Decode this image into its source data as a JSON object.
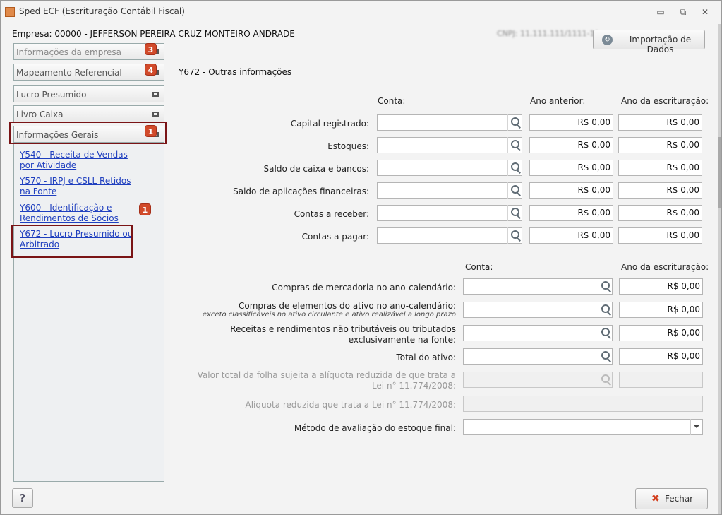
{
  "window": {
    "title": "Sped ECF (Escrituração Contábil Fiscal)",
    "icons": {
      "app": "spreadsheet-icon",
      "minimize": "minimize-icon",
      "maximize": "restore-icon",
      "close": "close-icon"
    },
    "minimize_glyph": "▭",
    "maximize_glyph": "⧉",
    "close_glyph": "✕"
  },
  "header": {
    "company": "Empresa: 00000 - JEFFERSON PEREIRA CRUZ MONTEIRO ANDRADE",
    "cnpj": "CNPJ: 11.111.111/1111-11",
    "import_button": "Importação de Dados",
    "import_icon": "import-circle-icon",
    "import_icon_glyph": "↻"
  },
  "sidebar": {
    "sections": [
      {
        "label": "Informações da empresa",
        "badge": "3"
      },
      {
        "label": "Mapeamento Referencial",
        "badge": "4"
      },
      {
        "label": "Lucro Presumido"
      },
      {
        "label": "Livro Caixa"
      },
      {
        "label": "Informações Gerais",
        "badge": "1"
      }
    ],
    "links": [
      {
        "label": "Y540 - Receita de Vendas por Atividade"
      },
      {
        "label": "Y570 - IRPJ e CSLL Retidos na Fonte"
      },
      {
        "label": "Y600 - Identificação e Rendimentos de Sócios",
        "badge": "1"
      },
      {
        "label": "Y672 - Lucro Presumido ou Arbitrado"
      }
    ]
  },
  "form": {
    "title": "Y672 - Outras informações",
    "section1": {
      "headers": {
        "conta": "Conta:",
        "anterior": "Ano anterior:",
        "escrituracao": "Ano da escrituração:"
      },
      "rows": [
        {
          "label": "Capital registrado:",
          "conta": "",
          "anterior": "R$ 0,00",
          "escrituracao": "R$ 0,00"
        },
        {
          "label": "Estoques:",
          "conta": "",
          "anterior": "R$ 0,00",
          "escrituracao": "R$ 0,00"
        },
        {
          "label": "Saldo de caixa e bancos:",
          "conta": "",
          "anterior": "R$ 0,00",
          "escrituracao": "R$ 0,00"
        },
        {
          "label": "Saldo de aplicações financeiras:",
          "conta": "",
          "anterior": "R$ 0,00",
          "escrituracao": "R$ 0,00"
        },
        {
          "label": "Contas a receber:",
          "conta": "",
          "anterior": "R$ 0,00",
          "escrituracao": "R$ 0,00"
        },
        {
          "label": "Contas a pagar:",
          "conta": "",
          "anterior": "R$ 0,00",
          "escrituracao": "R$ 0,00"
        }
      ]
    },
    "section2": {
      "headers": {
        "conta": "Conta:",
        "escrituracao": "Ano da escrituração:"
      },
      "rows": [
        {
          "label": "Compras de mercadoria no ano-calendário:",
          "sub": "",
          "conta": "",
          "escrituracao": "R$ 0,00"
        },
        {
          "label": "Compras de elementos do ativo no ano-calendário:",
          "sub": "exceto classificáveis no ativo circulante e ativo realizável a longo prazo",
          "conta": "",
          "escrituracao": "R$ 0,00"
        },
        {
          "label": "Receitas e rendimentos não tributáveis ou tributados exclusivamente na fonte:",
          "sub": "",
          "conta": "",
          "escrituracao": "R$ 0,00"
        },
        {
          "label": "Total do ativo:",
          "sub": "",
          "conta": "",
          "escrituracao": "R$ 0,00"
        }
      ],
      "folha_label": "Valor total da folha sujeita a alíquota reduzida de que trata a Lei n° 11.774/2008:",
      "aliquota_label": "Alíquota reduzida que trata a Lei n° 11.774/2008:",
      "metodo_label": "Método de avaliação do estoque final:",
      "metodo_value": ""
    }
  },
  "footer": {
    "help": "?",
    "close": "Fechar",
    "close_icon": "x-icon",
    "close_glyph": "✖"
  }
}
